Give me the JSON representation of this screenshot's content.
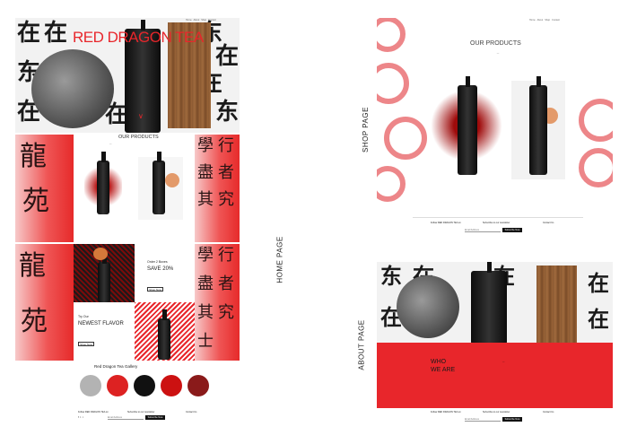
{
  "labels": {
    "home_page": "HOME PAGE",
    "shop_page": "SHOP PAGE",
    "about_page": "ABOUT PAGE"
  },
  "home": {
    "hero_title": "RED DRAGON TEA",
    "products_title": "OUR PRODUCTS",
    "promo_top": "Order 2 Boxes",
    "promo_main": "SAVE 20%",
    "promo_button": "Shop Now",
    "try_label": "Try Our",
    "newest_flavor": "NEWEST FLAVOR",
    "newest_button": "Shop Now",
    "gallery_title": "Red Dragon Tea Gallery"
  },
  "shop": {
    "title": "OUR PRODUCTS"
  },
  "about": {
    "who_line1": "WHO",
    "who_line2": "WE ARE"
  },
  "footer": {
    "follow": "Follow RED DRAGON TEA on",
    "subscribe": "Subscribe to our newsletter",
    "contact": "Contact Us",
    "email_placeholder": "Email Address",
    "subscribe_button": "Subscribe Now"
  },
  "colors": {
    "brand_red": "#e8262b"
  }
}
